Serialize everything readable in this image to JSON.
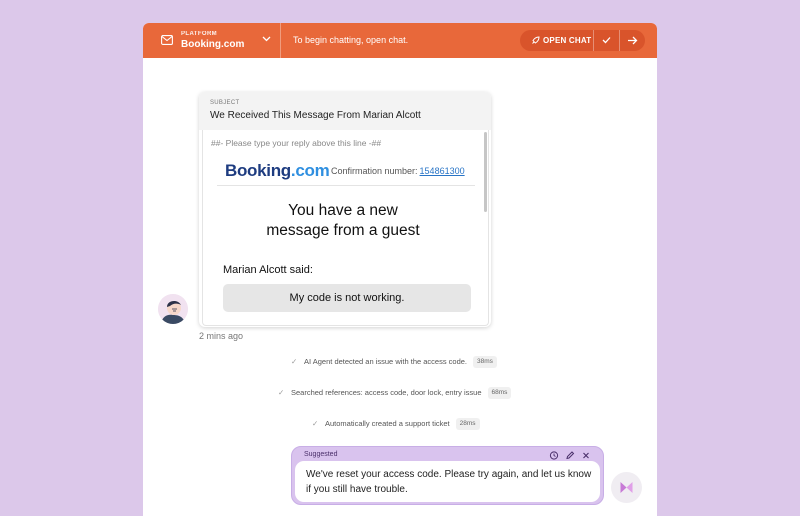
{
  "header": {
    "platform_kicker": "PLATFORM",
    "platform_name": "Booking.com",
    "hint": "To begin chatting, open chat.",
    "open_chat_label": "OPEN CHAT"
  },
  "email": {
    "subject_label": "SUBJECT",
    "subject": "We Received This Message From Marian Alcott",
    "reply_line": "##- Please type your reply above this line -##",
    "brand_name": "Booking",
    "brand_dot": ".",
    "brand_tld": "com",
    "confirmation_label": "Confirmation number:",
    "confirmation_number": "154861300",
    "headline_1": "You have a new",
    "headline_2": "message from a guest",
    "said": "Marian Alcott said:",
    "message": "My code is not working."
  },
  "timestamp": "2 mins ago",
  "steps": [
    {
      "text": "AI Agent detected an issue with the access code.",
      "time": "38ms"
    },
    {
      "text": "Searched references: access code, door lock, entry issue",
      "time": "68ms"
    },
    {
      "text": "Automatically created a support ticket",
      "time": "28ms"
    }
  ],
  "suggestion": {
    "label": "Suggested",
    "text": "We've reset your access code. Please try again, and let us know if you still have trouble."
  },
  "colors": {
    "background": "#dcc8ea",
    "header": "#e8683a",
    "accent_button": "#d9542b",
    "brand_blue": "#1e3c80",
    "suggestion_bg": "#d9c3ee"
  },
  "icons": [
    "mail-icon",
    "chevron-down-icon",
    "rocket-icon",
    "check-icon",
    "arrow-right-icon",
    "regenerate-icon",
    "pencil-icon",
    "close-icon",
    "bot-logo-icon"
  ]
}
